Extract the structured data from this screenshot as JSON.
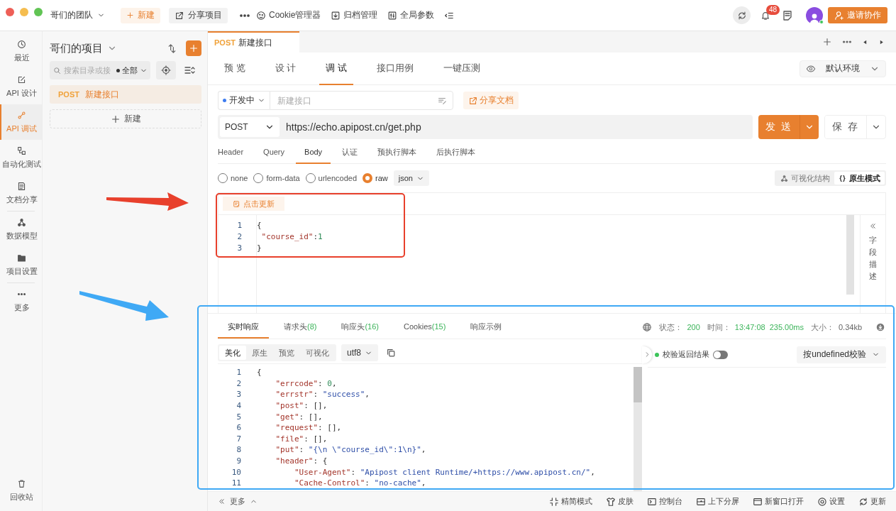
{
  "top_bar": {
    "team": "哥们的团队",
    "new_button": "新建",
    "share_button": "分享项目",
    "tools": [
      {
        "label": "Cookie管理器"
      },
      {
        "label": "归档管理"
      },
      {
        "label": "全局参数"
      }
    ],
    "notification_count": "48",
    "invite_button": "邀请协作"
  },
  "nav_rail": {
    "items": [
      {
        "label": "最近",
        "selected": false
      },
      {
        "label": "API 设计",
        "selected": false
      },
      {
        "label": "API 调试",
        "selected": true
      },
      {
        "label": "自动化测试",
        "selected": false
      },
      {
        "label": "文档分享",
        "selected": false
      },
      {
        "label": "数据模型",
        "selected": false
      },
      {
        "label": "项目设置",
        "selected": false
      },
      {
        "label": "更多",
        "selected": false
      }
    ],
    "trash": "回收站"
  },
  "project_panel": {
    "title": "哥们的项目",
    "search_placeholder": "搜索目录或接",
    "filter": "全部",
    "items": [
      {
        "method": "POST",
        "name": "新建接口",
        "selected": true
      }
    ],
    "new_button": "新建"
  },
  "open_tabs": [
    {
      "method": "POST",
      "name": "新建接口",
      "selected": true
    }
  ],
  "view_tabs": [
    {
      "label": "预 览",
      "selected": false
    },
    {
      "label": "设 计",
      "selected": false
    },
    {
      "label": "调 试",
      "selected": true
    },
    {
      "label": "接口用例",
      "selected": false
    },
    {
      "label": "一键压测",
      "selected": false
    }
  ],
  "environment": "默认环境",
  "request": {
    "status": "开发中",
    "name_placeholder": "新建接口",
    "share_doc": "分享文档",
    "method": "POST",
    "url": "https://echo.apipost.cn/get.php",
    "send": "发 送",
    "save": "保 存",
    "param_tabs": [
      {
        "label": "Header",
        "selected": false
      },
      {
        "label": "Query",
        "selected": false
      },
      {
        "label": "Body",
        "selected": true
      },
      {
        "label": "认证",
        "selected": false
      },
      {
        "label": "预执行脚本",
        "selected": false
      },
      {
        "label": "后执行脚本",
        "selected": false
      }
    ],
    "body_types": [
      {
        "label": "none",
        "selected": false
      },
      {
        "label": "form-data",
        "selected": false
      },
      {
        "label": "urlencoded",
        "selected": false
      },
      {
        "label": "raw",
        "selected": true
      }
    ],
    "format": "json",
    "modes": [
      {
        "label": "可视化结构",
        "selected": false
      },
      {
        "label": "原生模式",
        "selected": true
      }
    ],
    "update_button": "点击更新",
    "code": [
      {
        "no": "1",
        "tokens": [
          {
            "kind": "punct",
            "text": "{"
          }
        ]
      },
      {
        "no": "2",
        "tokens": [
          {
            "kind": "key",
            "text": " \"course_id\""
          },
          {
            "kind": "punct",
            "text": ":"
          },
          {
            "kind": "num",
            "text": "1"
          }
        ]
      },
      {
        "no": "3",
        "tokens": [
          {
            "kind": "punct",
            "text": "}"
          }
        ]
      }
    ],
    "side_panel": "字段描述"
  },
  "response": {
    "tabs": [
      {
        "label": "实时响应",
        "selected": true
      },
      {
        "label": "请求头",
        "count": "(8)",
        "selected": false
      },
      {
        "label": "响应头",
        "count": "(16)",
        "selected": false
      },
      {
        "label": "Cookies",
        "count": "(15)",
        "selected": false
      },
      {
        "label": "响应示例",
        "selected": false
      }
    ],
    "status_info": [
      {
        "label": "状态：",
        "value": "200",
        "kind": "ok"
      },
      {
        "label": "时间：",
        "value": "13:47:08",
        "kind": "ok"
      },
      {
        "value": "235.00ms",
        "kind": "ok"
      },
      {
        "label": "大小：",
        "value": "0.34kb",
        "kind": "plain"
      }
    ],
    "view_modes": [
      {
        "label": "美化",
        "selected": true
      },
      {
        "label": "原生",
        "selected": false
      },
      {
        "label": "预览",
        "selected": false
      },
      {
        "label": "可视化",
        "selected": false
      }
    ],
    "encoding": "utf8",
    "code": [
      {
        "no": "1",
        "tokens": [
          {
            "kind": "punct",
            "text": "{"
          }
        ]
      },
      {
        "no": "2",
        "tokens": [
          {
            "kind": "key",
            "text": "    \"errcode\""
          },
          {
            "kind": "punct",
            "text": ": "
          },
          {
            "kind": "num",
            "text": "0"
          },
          {
            "kind": "punct",
            "text": ","
          }
        ]
      },
      {
        "no": "3",
        "tokens": [
          {
            "kind": "key",
            "text": "    \"errstr\""
          },
          {
            "kind": "punct",
            "text": ": "
          },
          {
            "kind": "str",
            "text": "\"success\""
          },
          {
            "kind": "punct",
            "text": ","
          }
        ]
      },
      {
        "no": "4",
        "tokens": [
          {
            "kind": "key",
            "text": "    \"post\""
          },
          {
            "kind": "punct",
            "text": ": [],"
          }
        ]
      },
      {
        "no": "5",
        "tokens": [
          {
            "kind": "key",
            "text": "    \"get\""
          },
          {
            "kind": "punct",
            "text": ": [],"
          }
        ]
      },
      {
        "no": "6",
        "tokens": [
          {
            "kind": "key",
            "text": "    \"request\""
          },
          {
            "kind": "punct",
            "text": ": [],"
          }
        ]
      },
      {
        "no": "7",
        "tokens": [
          {
            "kind": "key",
            "text": "    \"file\""
          },
          {
            "kind": "punct",
            "text": ": [],"
          }
        ]
      },
      {
        "no": "8",
        "tokens": [
          {
            "kind": "key",
            "text": "    \"put\""
          },
          {
            "kind": "punct",
            "text": ": "
          },
          {
            "kind": "str",
            "text": "\"{\\n \\\"course_id\\\":1\\n}\""
          },
          {
            "kind": "punct",
            "text": ","
          }
        ]
      },
      {
        "no": "9",
        "tokens": [
          {
            "kind": "key",
            "text": "    \"header\""
          },
          {
            "kind": "punct",
            "text": ": {"
          }
        ]
      },
      {
        "no": "10",
        "tokens": [
          {
            "kind": "key",
            "text": "        \"User-Agent\""
          },
          {
            "kind": "punct",
            "text": ": "
          },
          {
            "kind": "str",
            "text": "\"Apipost client Runtime/+https://www.apipost.cn/\""
          },
          {
            "kind": "punct",
            "text": ","
          }
        ]
      },
      {
        "no": "11",
        "tokens": [
          {
            "kind": "key",
            "text": "        \"Cache-Control\""
          },
          {
            "kind": "punct",
            "text": ": "
          },
          {
            "kind": "str",
            "text": "\"no-cache\""
          },
          {
            "kind": "punct",
            "text": ","
          }
        ]
      }
    ],
    "validation_label": "校验返回结果",
    "validation_on": false,
    "validation_mode": "按undefined校验"
  },
  "status_bar": {
    "more": "更多",
    "items": [
      {
        "label": "精简模式"
      },
      {
        "label": "皮肤"
      },
      {
        "label": "控制台"
      },
      {
        "label": "上下分屏"
      },
      {
        "label": "新窗口打开"
      },
      {
        "label": "设置"
      },
      {
        "label": "更新"
      }
    ]
  },
  "annotations": [
    {
      "kind": "arrow",
      "color": "#e8402c"
    },
    {
      "kind": "frame",
      "color": "#e8402c"
    },
    {
      "kind": "arrow",
      "color": "#3fa9f5"
    },
    {
      "kind": "frame",
      "color": "#3fa9f5"
    }
  ]
}
